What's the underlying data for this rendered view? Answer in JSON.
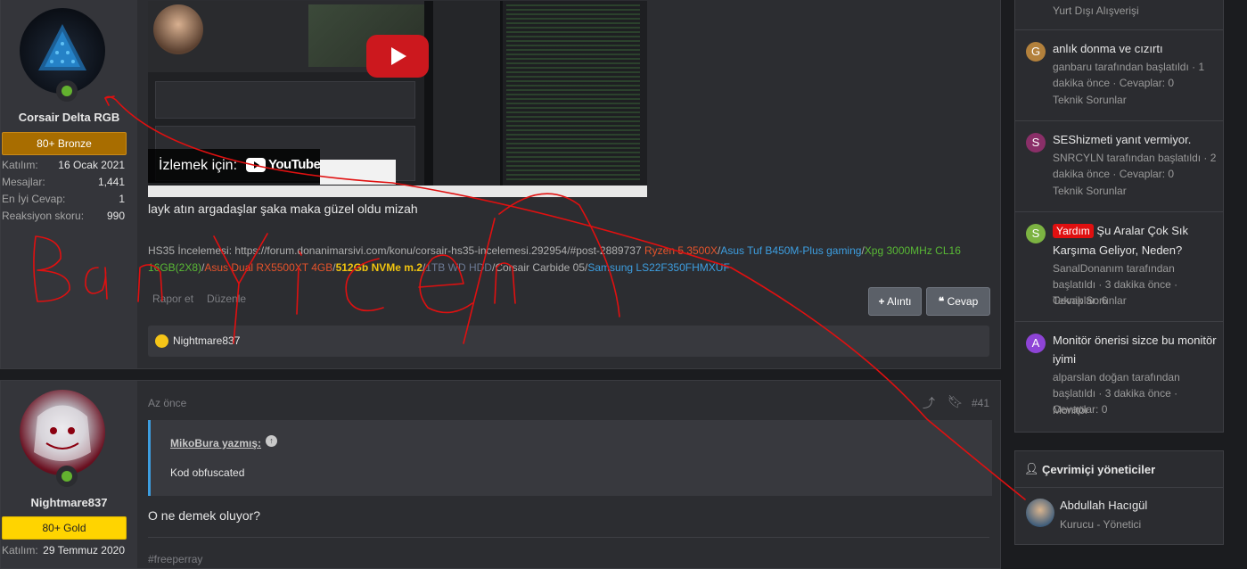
{
  "post1": {
    "user": {
      "name": "Corsair Delta RGB",
      "badge": "80+ Bronze",
      "stats": [
        {
          "k": "Katılım:",
          "v": "16 Ocak 2021"
        },
        {
          "k": "Mesajlar:",
          "v": "1,441"
        },
        {
          "k": "En İyi Cevap:",
          "v": "1"
        },
        {
          "k": "Reaksiyon skoru:",
          "v": "990"
        }
      ]
    },
    "video": {
      "watch_label": "İzlemek için:",
      "youtube_label": "YouTube"
    },
    "body_text": "layk atın argadaşlar şaka maka güzel oldu mizah",
    "signature": [
      {
        "t": "HS35 İncelemesi: ",
        "c": "#b0b0b0"
      },
      {
        "t": "https://forum.donanimarsivi.com/konu/corsair-hs35-incelemesi.292954/#post-2889737",
        "c": "#b0b0b0"
      },
      {
        "t": " Ryzen 5 3500X",
        "c": "#e5532b"
      },
      {
        "t": "/",
        "c": "#b0b0b0"
      },
      {
        "t": "Asus Tuf B450M-Plus gaming",
        "c": "#3d9ee0"
      },
      {
        "t": "/",
        "c": "#b0b0b0"
      },
      {
        "t": "Xpg 3000MHz CL16 16GB(2X8)",
        "c": "#59b935"
      },
      {
        "t": "/",
        "c": "#b0b0b0"
      },
      {
        "t": "Asus Dual RX5500XT 4GB",
        "c": "#e5532b"
      },
      {
        "t": "/",
        "c": "#b0b0b0"
      },
      {
        "t": "512Gb NVMe m.2",
        "c": "#f1c40f"
      },
      {
        "t": "/",
        "c": "#b0b0b0"
      },
      {
        "t": "1TB WD HDD",
        "c": "#6c7a94"
      },
      {
        "t": "/",
        "c": "#b0b0b0"
      },
      {
        "t": "Corsair Carbide 05",
        "c": "#b0b0b0"
      },
      {
        "t": "/",
        "c": "#b0b0b0"
      },
      {
        "t": "Samsung LS22F350FHMXUF",
        "c": "#3d9ee0"
      }
    ],
    "actions": {
      "report": "Rapor et",
      "edit": "Düzenle",
      "quote": "Alıntı",
      "reply": "Cevap"
    },
    "reaction_user": "Nightmare837"
  },
  "post2": {
    "user": {
      "name": "Nightmare837",
      "badge": "80+ Gold",
      "stats": [
        {
          "k": "Katılım:",
          "v": "29 Temmuz 2020"
        }
      ]
    },
    "time": "Az önce",
    "post_number": "#41",
    "quote_author": "MikoBura yazmış:",
    "quote_text": "Kod obfuscated",
    "body_text": "O ne demek oluyor?",
    "signature_partial": "#freeperray"
  },
  "sidebar": {
    "top_forum": "Yurt Dışı Alışverişi",
    "threads": [
      {
        "letter": "G",
        "color": "#b3813c",
        "prefix": "",
        "title": "anlık donma ve cızırtı",
        "meta": "ganbaru tarafından başlatıldı · 1 dakika önce · Cevaplar: 0",
        "forum": "Teknik Sorunlar"
      },
      {
        "letter": "S",
        "color": "#8a2f68",
        "prefix": "",
        "title": "SEShizmeti yanıt vermiyor.",
        "meta": "SNRCYLN tarafından başlatıldı · 2 dakika önce · Cevaplar: 0",
        "forum": "Teknik Sorunlar"
      },
      {
        "letter": "S",
        "color": "#7cb342",
        "prefix": "Yardım",
        "title": "Şu Aralar Çok Sık Karşıma Geliyor, Neden?",
        "meta": "SanalDonanım tarafından başlatıldı · 3 dakika önce · Cevaplar: 6",
        "forum": "Teknik Sorunlar"
      },
      {
        "letter": "A",
        "color": "#8e44d6",
        "prefix": "",
        "title": "Monitör önerisi sizce bu monitör iyimi",
        "meta": "alparslan doğan tarafından başlatıldı · 3 dakika önce · Cevaplar: 0",
        "forum": "Monitör"
      }
    ],
    "staff": {
      "title": "Çevrimiçi yöneticiler",
      "name": "Abdullah Hacıgül",
      "role": "Kurucu - Yönetici"
    }
  },
  "annotation_text": "Ban Yicem",
  "colors": {
    "bronze": "#a86d00",
    "gold": "#ffd400",
    "annotation": "#e01010",
    "accent": "#3d9ee0"
  }
}
